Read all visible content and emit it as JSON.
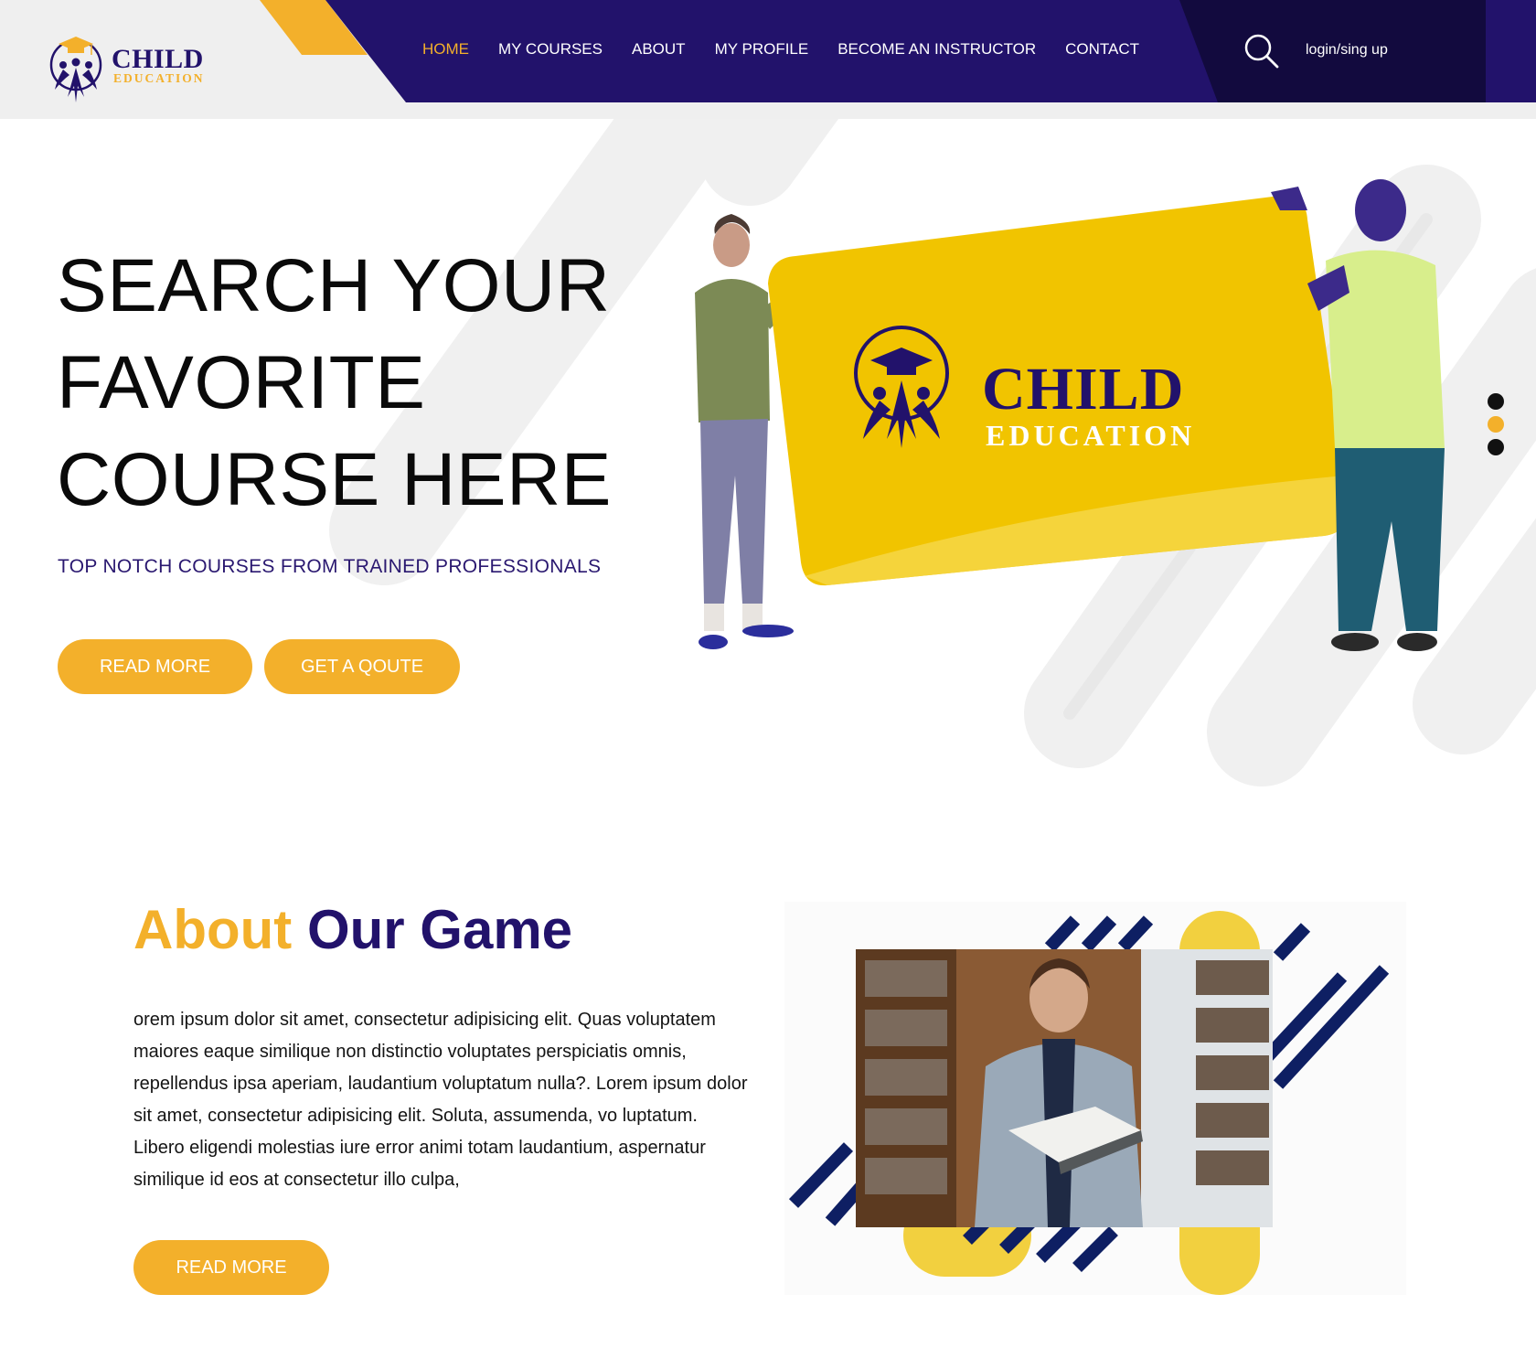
{
  "brand": {
    "name": "CHILD",
    "tagline": "EDUCATION",
    "colors": {
      "primary": "#22126b",
      "accent": "#f3b02b",
      "dark": "#120a3e"
    }
  },
  "nav": {
    "items": [
      {
        "label": "HOME",
        "active": true
      },
      {
        "label": "MY COURSES",
        "active": false
      },
      {
        "label": "ABOUT",
        "active": false
      },
      {
        "label": "MY PROFILE",
        "active": false
      },
      {
        "label": "BECOME AN INSTRUCTOR",
        "active": false
      },
      {
        "label": "CONTACT",
        "active": false
      }
    ],
    "search_icon": "search-icon",
    "login_label": "login/sing up"
  },
  "hero": {
    "title_lines": [
      "SEARCH YOUR",
      "FAVORITE",
      "COURSE HERE"
    ],
    "subtitle": "TOP NOTCH COURSES FROM TRAINED PROFESSIONALS",
    "read_more_label": "READ MORE",
    "quote_label": "GET A QOUTE",
    "card_name": "CHILD",
    "card_tagline": "EDUCATION",
    "slider_count": 3,
    "slider_active": 2
  },
  "about": {
    "title_part1": "About",
    "title_part2": "Our Game",
    "text": "orem ipsum dolor sit amet, consectetur adipisicing elit. Quas voluptatem maiores eaque similique non distinctio voluptates perspiciatis omnis, repellendus ipsa aperiam, laudantium voluptatum nulla?. Lorem ipsum dolor sit amet, consectetur adipisicing elit. Soluta, assumenda, vo luptatum. Libero eligendi molestias iure error animi totam laudantium, aspernatur similique id eos at consectetur illo culpa,",
    "read_more_label": "READ MORE"
  }
}
